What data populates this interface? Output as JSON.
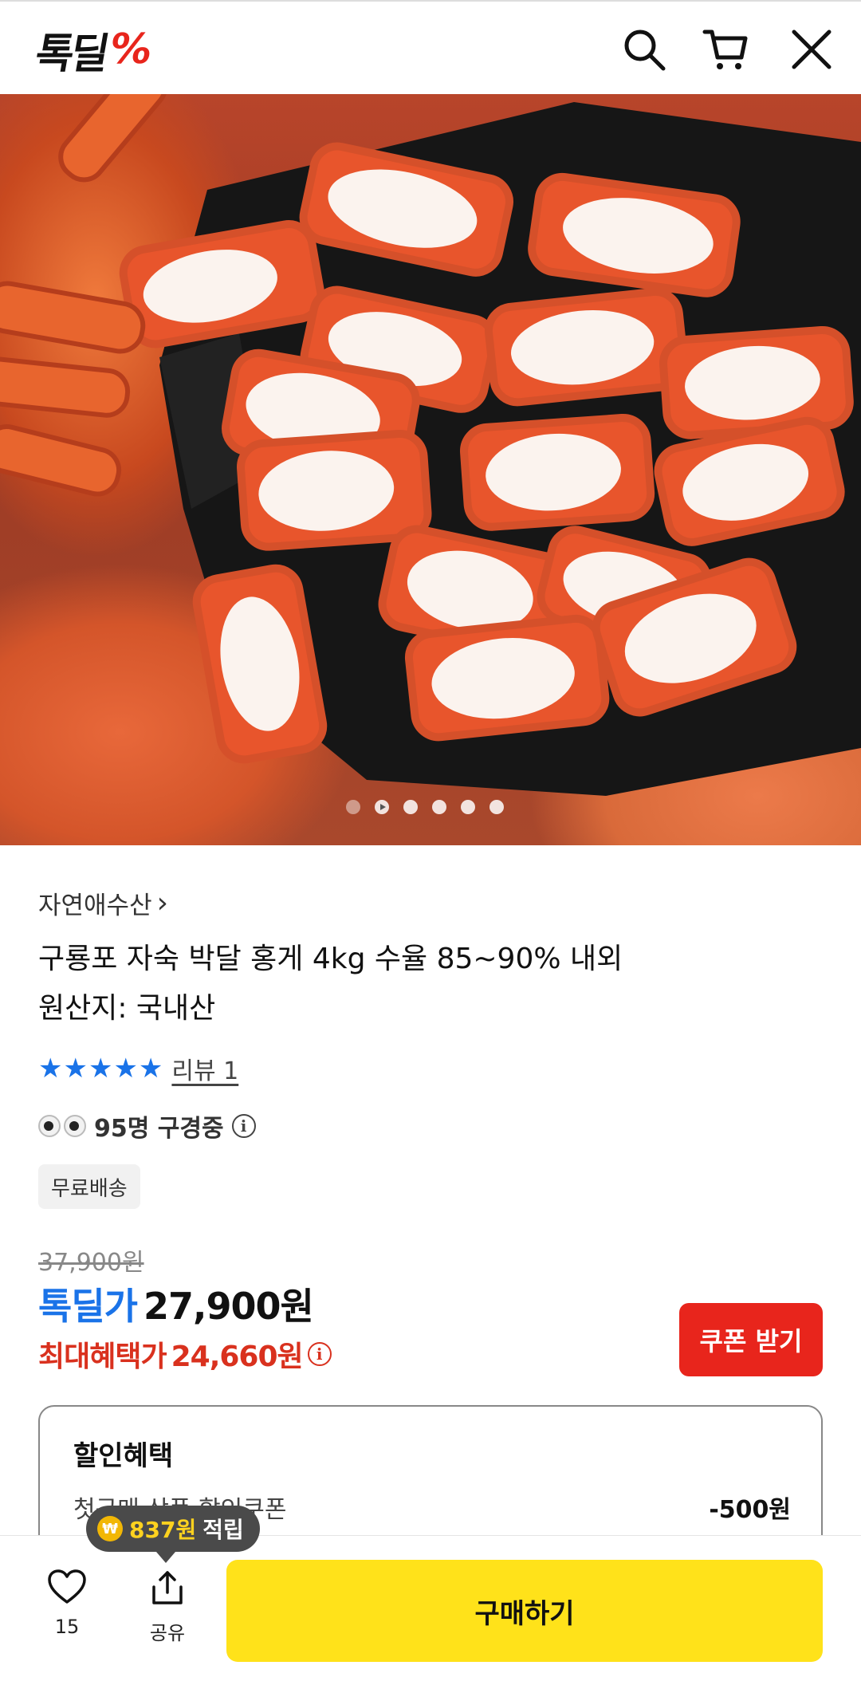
{
  "header": {
    "logo_text": "톡딜",
    "logo_symbol": "%",
    "icons": [
      "search-icon",
      "cart-icon",
      "close-icon"
    ]
  },
  "hero": {
    "image_alt": "",
    "carousel": {
      "total": 6,
      "active_index": 0
    }
  },
  "product": {
    "seller": "자연애수산",
    "seller_chevron": "›",
    "title_line1": "구룡포 자숙 박달 홍게 4kg 수율 85~90% 내외",
    "title_line2": "원산지: 국내산",
    "stars": "★★★★★",
    "rating_value": 5,
    "review_label": "리뷰 1",
    "viewers_text": "95명 구경중",
    "badge": "무료배송"
  },
  "price": {
    "original": "37,900원",
    "deal_label": "톡딜가",
    "deal_price": "27,900원",
    "max_label": "최대혜택가",
    "max_price": "24,660원",
    "coupon_button": "쿠폰 받기"
  },
  "discount": {
    "title": "할인혜택",
    "rows": [
      {
        "name": "첫구매 상품 할인쿠폰",
        "value": "-500원"
      }
    ]
  },
  "tooltip": {
    "coin_symbol": "₩",
    "amount": "837원",
    "suffix": "적립"
  },
  "bottom_bar": {
    "like_count": "15",
    "share_label": "공유",
    "buy_label": "구매하기"
  },
  "colors": {
    "accent_blue": "#1a73e8",
    "accent_red": "#e8251c",
    "buy_yellow": "#ffe21a"
  }
}
